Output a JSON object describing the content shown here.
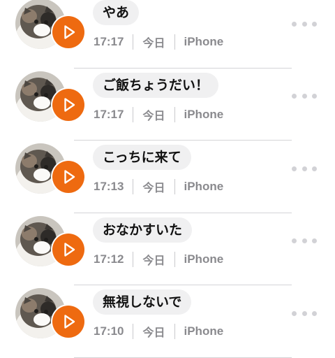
{
  "messages": [
    {
      "text": "やあ",
      "time": "17:17",
      "date": "今日",
      "device": "iPhone",
      "play_icon": "play-icon",
      "more_icon": "more-dots-icon"
    },
    {
      "text": "ご飯ちょうだい！",
      "time": "17:17",
      "date": "今日",
      "device": "iPhone",
      "play_icon": "play-icon",
      "more_icon": "more-dots-icon"
    },
    {
      "text": "こっちに来て",
      "time": "17:13",
      "date": "今日",
      "device": "iPhone",
      "play_icon": "play-icon",
      "more_icon": "more-dots-icon"
    },
    {
      "text": "おなかすいた",
      "time": "17:12",
      "date": "今日",
      "device": "iPhone",
      "play_icon": "play-icon",
      "more_icon": "more-dots-icon"
    },
    {
      "text": "無視しないで",
      "time": "17:10",
      "date": "今日",
      "device": "iPhone",
      "play_icon": "play-icon",
      "more_icon": "more-dots-icon"
    }
  ],
  "colors": {
    "play_button": "#ee6a10",
    "bubble_background": "#f0f0f1",
    "meta_text": "#8a8a8e",
    "more_dots": "#d2d2d6",
    "divider": "#d4d4d7"
  }
}
